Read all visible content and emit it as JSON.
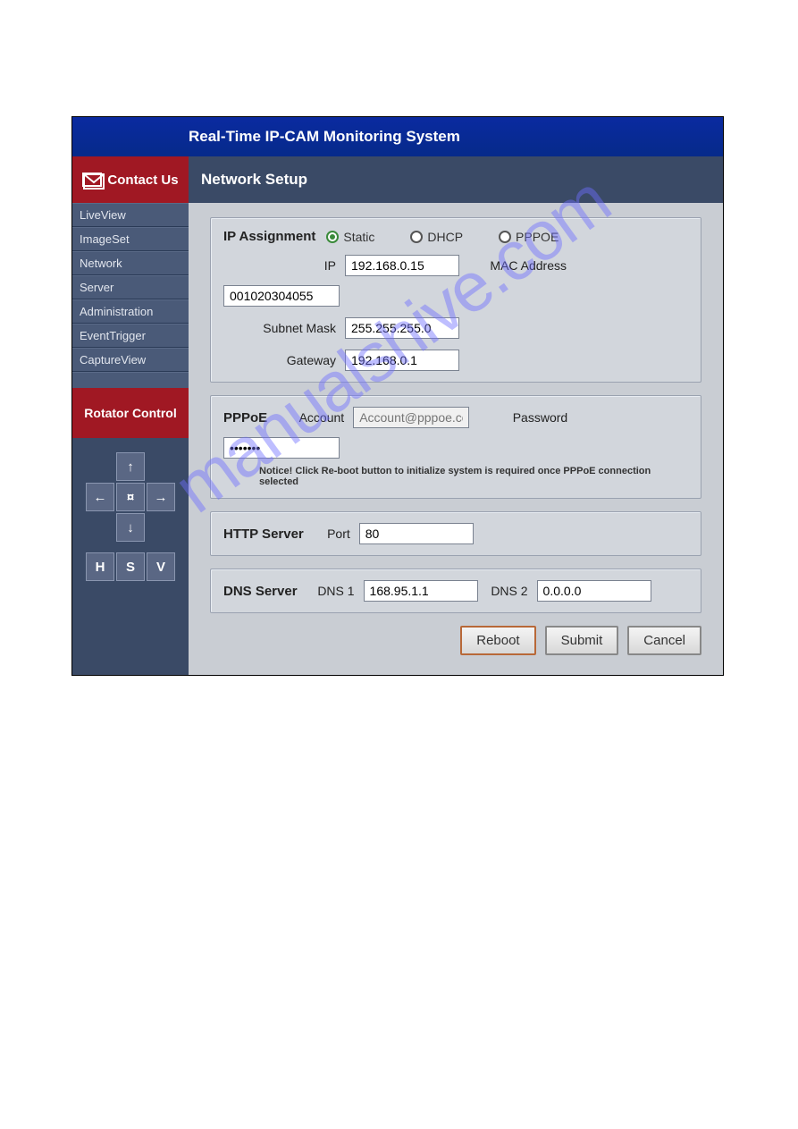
{
  "titlebar": {
    "text": "Real-Time IP-CAM Monitoring System"
  },
  "header": {
    "contact_label": "Contact Us",
    "page_title": "Network Setup"
  },
  "sidebar": {
    "items": [
      {
        "label": "LiveView"
      },
      {
        "label": "ImageSet"
      },
      {
        "label": "Network"
      },
      {
        "label": "Server"
      },
      {
        "label": "Administration"
      },
      {
        "label": "EventTrigger"
      },
      {
        "label": "CaptureView"
      }
    ],
    "rotator_label": "Rotator Control",
    "ptz": {
      "up": "↑",
      "left": "←",
      "center": "¤",
      "right": "→",
      "down": "↓",
      "H": "H",
      "S": "S",
      "V": "V"
    }
  },
  "ip_assignment": {
    "title": "IP Assignment",
    "options": {
      "static": "Static",
      "dhcp": "DHCP",
      "pppoe": "PPPOE"
    },
    "fields": {
      "ip_label": "IP",
      "ip_value": "192.168.0.15",
      "mac_label": "MAC Address",
      "mac_value": "001020304055",
      "subnet_label": "Subnet Mask",
      "subnet_value": "255.255.255.0",
      "gateway_label": "Gateway",
      "gateway_value": "192.168.0.1"
    }
  },
  "pppoe": {
    "title": "PPPoE",
    "account_label": "Account",
    "account_placeholder": "Account@pppoe.com",
    "password_label": "Password",
    "password_value": "•••••••",
    "notice": "Notice! Click Re-boot button to initialize system is required once PPPoE connection selected"
  },
  "http": {
    "title": "HTTP Server",
    "port_label": "Port",
    "port_value": "80"
  },
  "dns": {
    "title": "DNS Server",
    "dns1_label": "DNS 1",
    "dns1_value": "168.95.1.1",
    "dns2_label": "DNS 2",
    "dns2_value": "0.0.0.0"
  },
  "buttons": {
    "reboot": "Reboot",
    "submit": "Submit",
    "cancel": "Cancel"
  },
  "watermark": "manualshive.com"
}
